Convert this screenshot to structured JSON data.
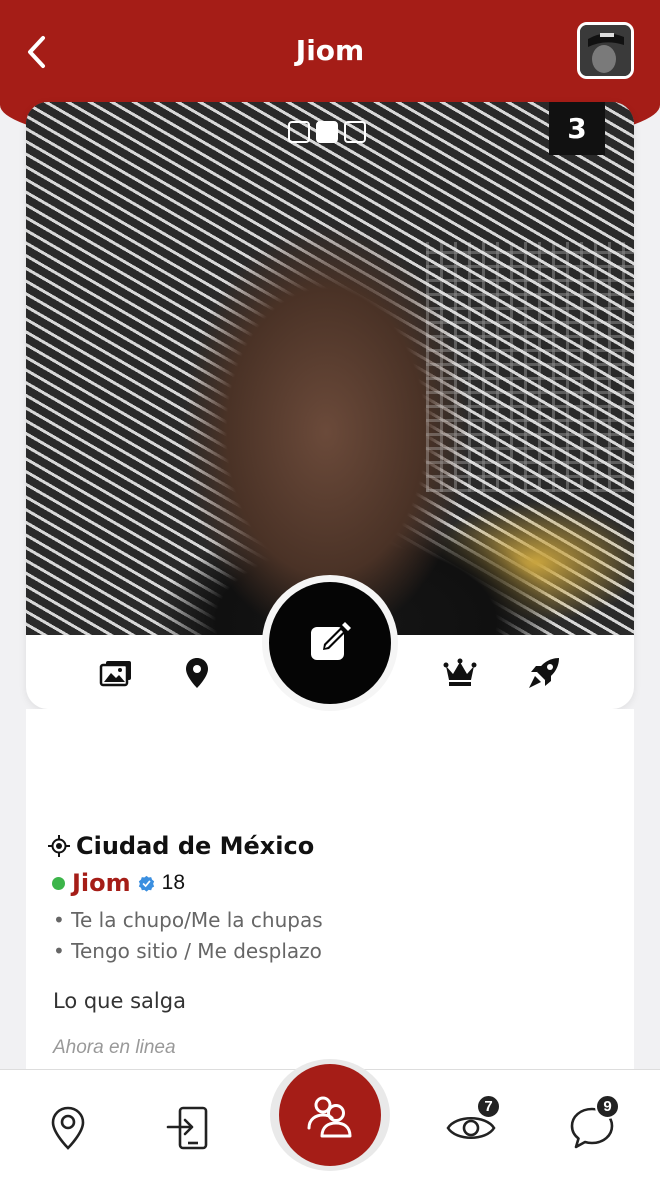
{
  "header": {
    "title": "Jiom"
  },
  "photo": {
    "count": "3",
    "total_indicators": 3,
    "active_indicator": 2
  },
  "profile": {
    "city": "Ciudad de México",
    "username": "Jiom",
    "age": "18",
    "tags": [
      "• Te la chupo/Me la chupas",
      "• Tengo sitio / Me desplazo"
    ],
    "bio": "Lo que salga",
    "status": "Ahora en linea"
  },
  "nav": {
    "views_badge": "7",
    "messages_badge": "9"
  },
  "colors": {
    "brand": "#a51d17",
    "online": "#3cb54a"
  },
  "icons": {
    "header_left": "chevron-left-icon",
    "actions": [
      "photos-icon",
      "location-pin-icon",
      "edit-icon",
      "crown-icon",
      "rocket-icon"
    ],
    "nav": [
      "map-pin-icon",
      "login-icon",
      "users-icon",
      "eye-icon",
      "chat-icon"
    ]
  }
}
